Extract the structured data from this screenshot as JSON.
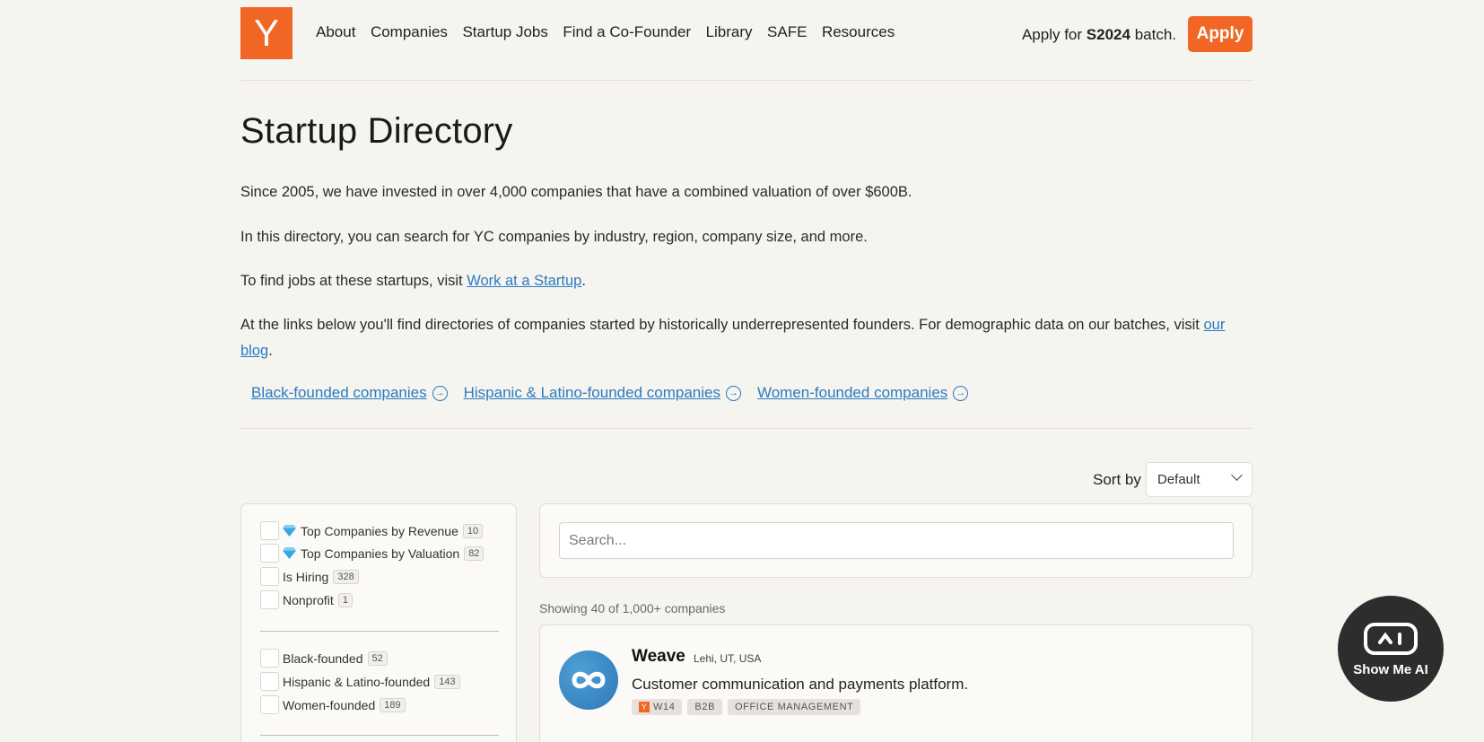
{
  "header": {
    "logo_letter": "Y",
    "nav": [
      "About",
      "Companies",
      "Startup Jobs",
      "Find a Co-Founder",
      "Library",
      "SAFE",
      "Resources"
    ],
    "apply_prefix": "Apply for",
    "apply_batch": "S2024",
    "apply_suffix": "batch.",
    "apply_button": "Apply"
  },
  "intro": {
    "title": "Startup Directory",
    "p1": "Since 2005, we have invested in over 4,000 companies that have a combined valuation of over $600B.",
    "p2": "In this directory, you can search for YC companies by industry, region, company size, and more.",
    "p3_prefix": "To find jobs at these startups, visit",
    "p3_link": "Work at a Startup",
    "p3_suffix": ".",
    "p4_prefix": "At the links below you'll find directories of companies started by historically underrepresented founders. For demographic data on our batches, visit",
    "p4_link": "our blog",
    "p4_suffix": "."
  },
  "demo_links": [
    "Black-founded companies",
    "Hispanic & Latino-founded companies",
    "Women-founded companies"
  ],
  "sort": {
    "label": "Sort by",
    "value": "Default"
  },
  "filters": {
    "group1": [
      {
        "label": "Top Companies by Revenue",
        "count": "10",
        "gem": true
      },
      {
        "label": "Top Companies by Valuation",
        "count": "82",
        "gem": true
      },
      {
        "label": "Is Hiring",
        "count": "328",
        "gem": false
      },
      {
        "label": "Nonprofit",
        "count": "1",
        "gem": false
      }
    ],
    "group2": [
      {
        "label": "Black-founded",
        "count": "52"
      },
      {
        "label": "Hispanic & Latino-founded",
        "count": "143"
      },
      {
        "label": "Women-founded",
        "count": "189"
      }
    ]
  },
  "search": {
    "placeholder": "Search..."
  },
  "results": {
    "showing": "Showing 40 of 1,000+ companies"
  },
  "company": {
    "name": "Weave",
    "location": "Lehi, UT, USA",
    "description": "Customer communication and payments platform.",
    "batch": "W14",
    "tags": [
      "B2B",
      "OFFICE MANAGEMENT"
    ]
  },
  "badge": {
    "label": "Show Me AI"
  },
  "colors": {
    "brand": "#f26625",
    "link": "#2a7bc2",
    "background": "#f5f4ef"
  }
}
